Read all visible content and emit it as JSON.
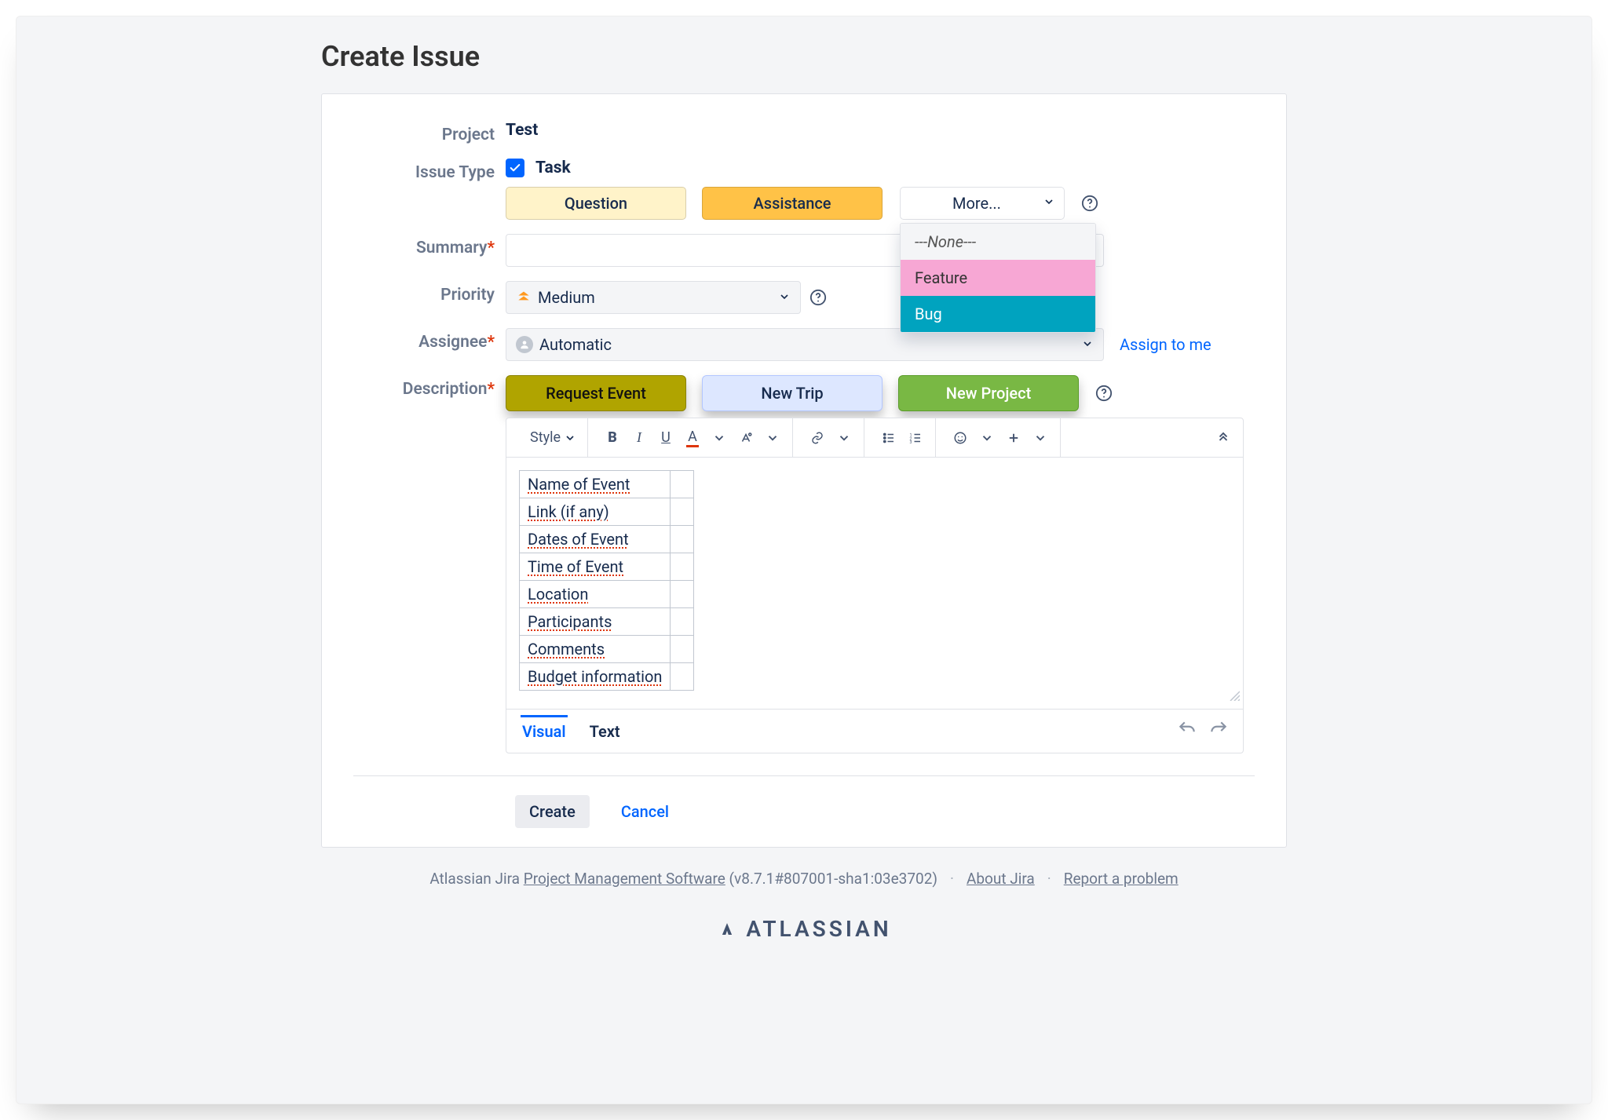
{
  "page": {
    "title": "Create Issue"
  },
  "labels": {
    "project": "Project",
    "issue_type": "Issue Type",
    "summary": "Summary",
    "priority": "Priority",
    "assignee": "Assignee",
    "description": "Description"
  },
  "project": {
    "value": "Test"
  },
  "issue_type": {
    "value": "Task",
    "buttons": {
      "question": "Question",
      "assistance": "Assistance"
    },
    "more": {
      "label": "More...",
      "options": {
        "none": "---None---",
        "feature": "Feature",
        "bug": "Bug"
      }
    }
  },
  "summary": {
    "value": ""
  },
  "priority": {
    "value": "Medium"
  },
  "assignee": {
    "value": "Automatic",
    "assign_to_me": "Assign to me"
  },
  "description": {
    "templates": {
      "request_event": "Request Event",
      "new_trip": "New Trip",
      "new_project": "New Project"
    },
    "toolbar": {
      "style": "Style"
    },
    "table_rows": [
      "Name of Event",
      "Link (if any)",
      "Dates of Event",
      "Time of Event",
      "Location",
      "Participants",
      "Comments",
      "Budget information"
    ],
    "tabs": {
      "visual": "Visual",
      "text": "Text"
    }
  },
  "actions": {
    "create": "Create",
    "cancel": "Cancel"
  },
  "footer": {
    "prefix": "Atlassian Jira ",
    "pms": "Project Management Software",
    "version": " (v8.7.1#807001-sha1:03e3702)",
    "about": "About Jira",
    "report": "Report a problem",
    "brand": "ATLASSIAN"
  }
}
